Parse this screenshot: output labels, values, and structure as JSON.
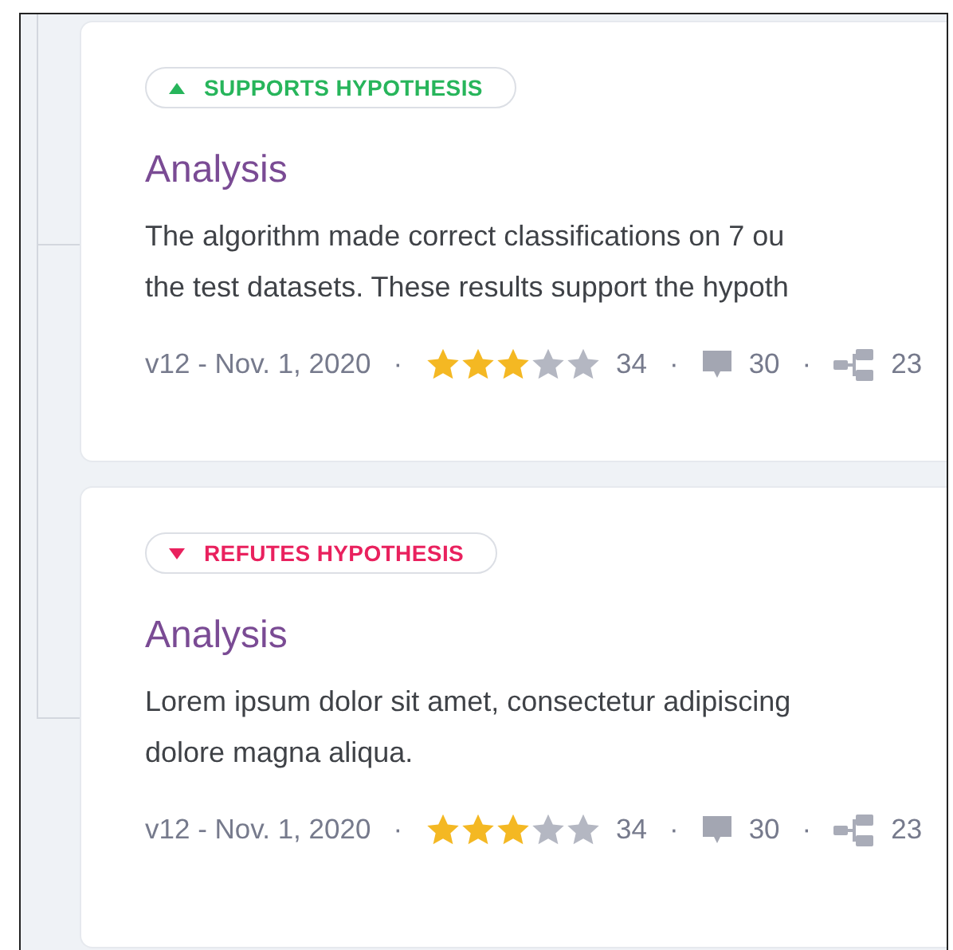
{
  "cards": [
    {
      "verdict": {
        "kind": "supports",
        "label": "SUPPORTS HYPOTHESIS"
      },
      "title": "Analysis",
      "description_lines": [
        "The algorithm made correct classifications on 7 ou",
        "the test datasets. These results support the hypoth"
      ],
      "meta": {
        "version": "v12 - Nov. 1, 2020",
        "separators": [
          "·",
          "·",
          "·"
        ],
        "stars": 3,
        "rating_count": "34",
        "comment_count": "30",
        "branch_count": "23"
      }
    },
    {
      "verdict": {
        "kind": "refutes",
        "label": "REFUTES HYPOTHESIS"
      },
      "title": "Analysis",
      "description_lines": [
        "Lorem ipsum dolor sit amet, consectetur adipiscing",
        "dolore magna aliqua."
      ],
      "meta": {
        "version": "v12 - Nov. 1, 2020",
        "separators": [
          "·",
          "·",
          "·"
        ],
        "stars": 3,
        "rating_count": "34",
        "comment_count": "30",
        "branch_count": "23"
      }
    }
  ]
}
